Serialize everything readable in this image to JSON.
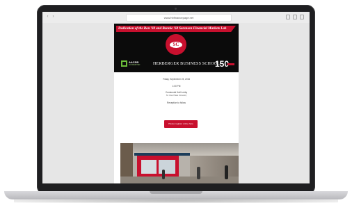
{
  "browser": {
    "address": "www.hbfinancepage.net",
    "back_glyph": "‹",
    "forward_glyph": "›"
  },
  "email": {
    "banner_title": "Dedication of the Ron '69 and Bonnie '68 Sorensen Financial Markets Lab",
    "logo_text": "SC",
    "aacsb": "AACSB",
    "aacsb_sub": "ACCREDITED",
    "school": "HERBERGER BUSINESS SCHOOL",
    "anniversary": "150",
    "date": "Friday, September 23, 2016",
    "time": "1:00 PM",
    "room1": "Centennial Hall Lobby",
    "room2": "St. Cloud State University",
    "reception": "Reception to follow",
    "rsvp": "Please register online here"
  },
  "colors": {
    "accent": "#c8102e",
    "banner_bg": "#0b0b0b"
  }
}
